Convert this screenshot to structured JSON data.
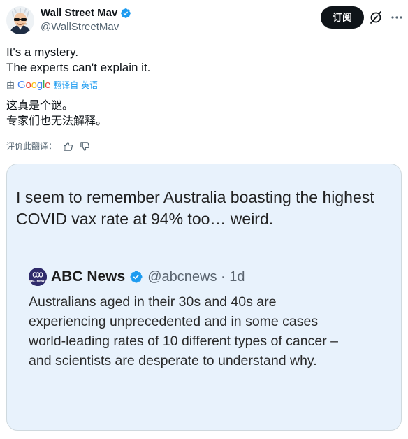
{
  "author": {
    "display_name": "Wall Street Mav",
    "handle": "@WallStreetMav",
    "avatar": "cartoon-avatar"
  },
  "actions": {
    "subscribe_label": "订阅",
    "grok_icon": "grok-icon",
    "more_icon": "more-icon"
  },
  "tweet": {
    "lines": [
      "It's a mystery.",
      "The experts can't explain it."
    ]
  },
  "translation": {
    "by_label": "由",
    "provider": [
      "G",
      "o",
      "o",
      "g",
      "l",
      "e"
    ],
    "link_label": "翻译自 英语",
    "lines": [
      "这真是个谜。",
      "专家们也无法解释。"
    ],
    "rate_label": "评价此翻译："
  },
  "media": {
    "headline_lines": [
      "I seem to remember Australia boasting the highest",
      "COVID vax rate at 94% too… weird."
    ],
    "quote": {
      "name": "ABC News",
      "handle_time": "@abcnews · 1d",
      "logo_text": "ABC NEWS",
      "body_lines": [
        "Australians aged in their 30s and 40s are",
        "experiencing unprecedented and in some cases",
        "world-leading rates of 10 different types of cancer –",
        "and scientists are desperate to understand why."
      ]
    }
  },
  "colors": {
    "accent": "#1d9bf0",
    "text": "#0f1419",
    "secondary_text": "#536471",
    "media_background": "#e8f2fc"
  }
}
